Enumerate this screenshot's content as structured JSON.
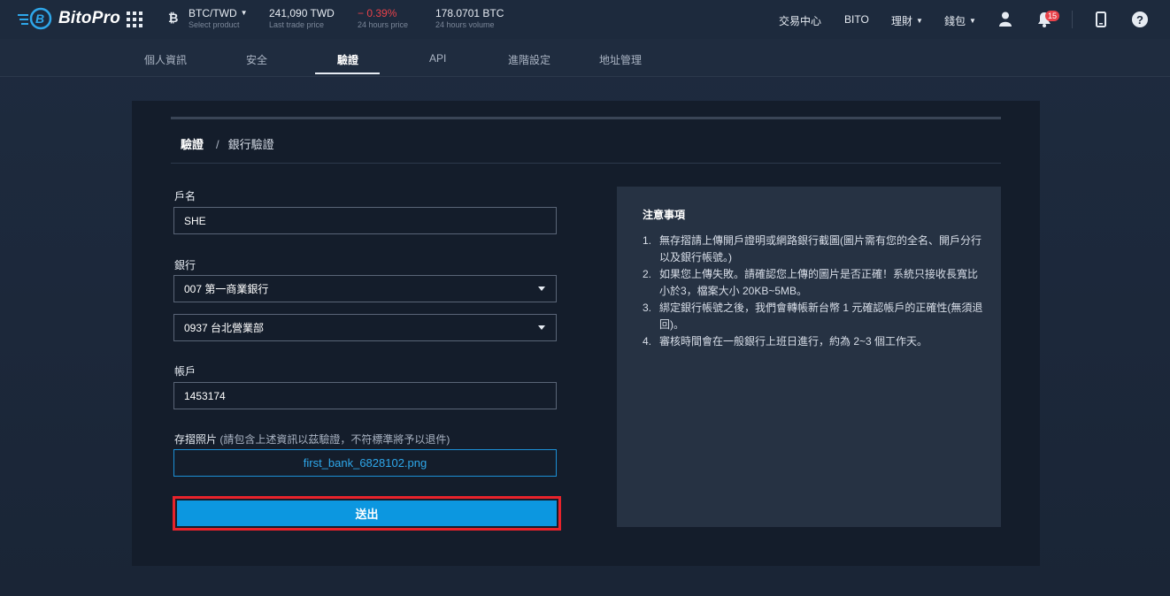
{
  "header": {
    "brand": "BitoPro",
    "product": {
      "pair": "BTC/TWD",
      "sublabel": "Select product"
    },
    "last_price": {
      "value": "241,090 TWD",
      "sublabel": "Last trade price"
    },
    "change": {
      "value": "− 0.39%",
      "sublabel": "24 hours price"
    },
    "volume": {
      "value": "178.0701 BTC",
      "sublabel": "24 hours volume"
    },
    "nav": [
      "交易中心",
      "BITO",
      "理財",
      "錢包"
    ],
    "notifications_count": "15",
    "colors": {
      "negative": "#e8424a",
      "accent": "#0c97e0"
    }
  },
  "subnav": {
    "tabs": [
      "個人資訊",
      "安全",
      "驗證",
      "API",
      "進階設定",
      "地址管理"
    ],
    "active": "驗證"
  },
  "breadcrumb": {
    "root": "驗證",
    "separator": "/",
    "current": "銀行驗證"
  },
  "form": {
    "account_name_label": "戶名",
    "account_name_value": "SHE",
    "bank_label": "銀行",
    "bank_value": "007 第一商業銀行",
    "branch_value": "0937 台北營業部",
    "account_label": "帳戶",
    "account_value": "1453174",
    "photo_label": "存摺照片",
    "photo_hint": "(請包含上述資訊以茲驗證，不符標準將予以退件)",
    "file_name": "first_bank_6828102.png",
    "submit_label": "送出"
  },
  "notice": {
    "title": "注意事項",
    "items": [
      {
        "num": "1.",
        "text": "無存摺請上傳開戶證明或網路銀行截圖(圖片需有您的全名、開戶分行以及銀行帳號。)"
      },
      {
        "num": "2.",
        "text": "如果您上傳失敗。請確認您上傳的圖片是否正確！系統只接收長寬比小於3，檔案大小 20KB~5MB。"
      },
      {
        "num": "3.",
        "text": "綁定銀行帳號之後，我們會轉帳新台幣 1 元確認帳戶的正確性(無須退回)。"
      },
      {
        "num": "4.",
        "text": "審核時間會在一般銀行上班日進行，約為 2~3 個工作天。"
      }
    ]
  },
  "icons": [
    "bitopro-logo-icon",
    "apps-grid-icon",
    "bitcoin-icon",
    "user-icon",
    "bell-icon",
    "mobile-icon",
    "help-icon",
    "dropdown-caret-icon"
  ]
}
